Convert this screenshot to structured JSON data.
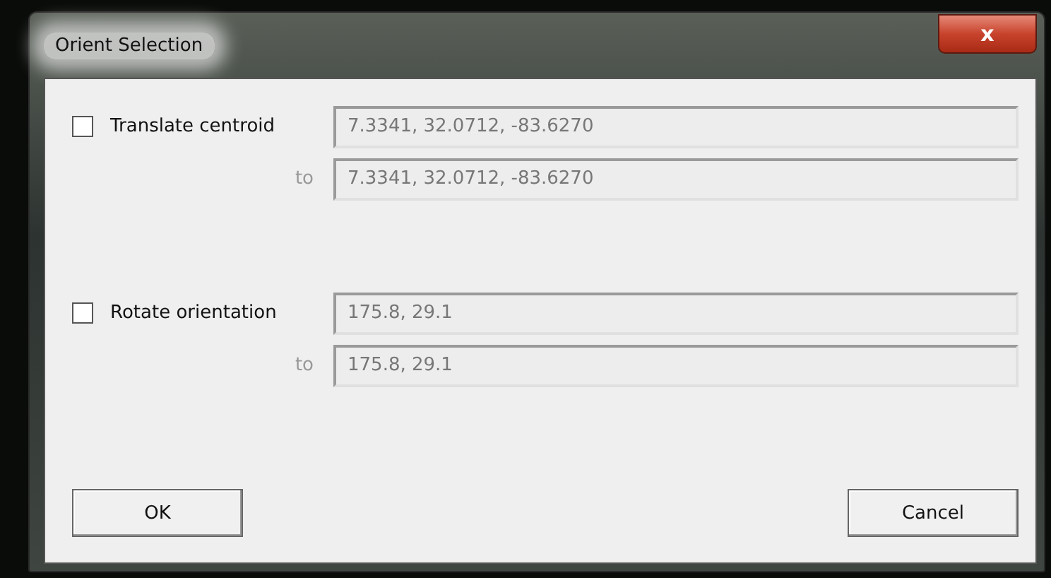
{
  "window": {
    "title": "Orient Selection",
    "close": "x"
  },
  "groups": [
    {
      "label": "Translate centroid",
      "checked": false,
      "value": "7.3341, 32.0712, -83.6270",
      "to_label": "to",
      "to_value": "7.3341, 32.0712, -83.6270"
    },
    {
      "label": "Rotate orientation",
      "checked": false,
      "value": "175.8, 29.1",
      "to_label": "to",
      "to_value": "175.8, 29.1"
    }
  ],
  "buttons": [
    "OK",
    "Cancel"
  ]
}
